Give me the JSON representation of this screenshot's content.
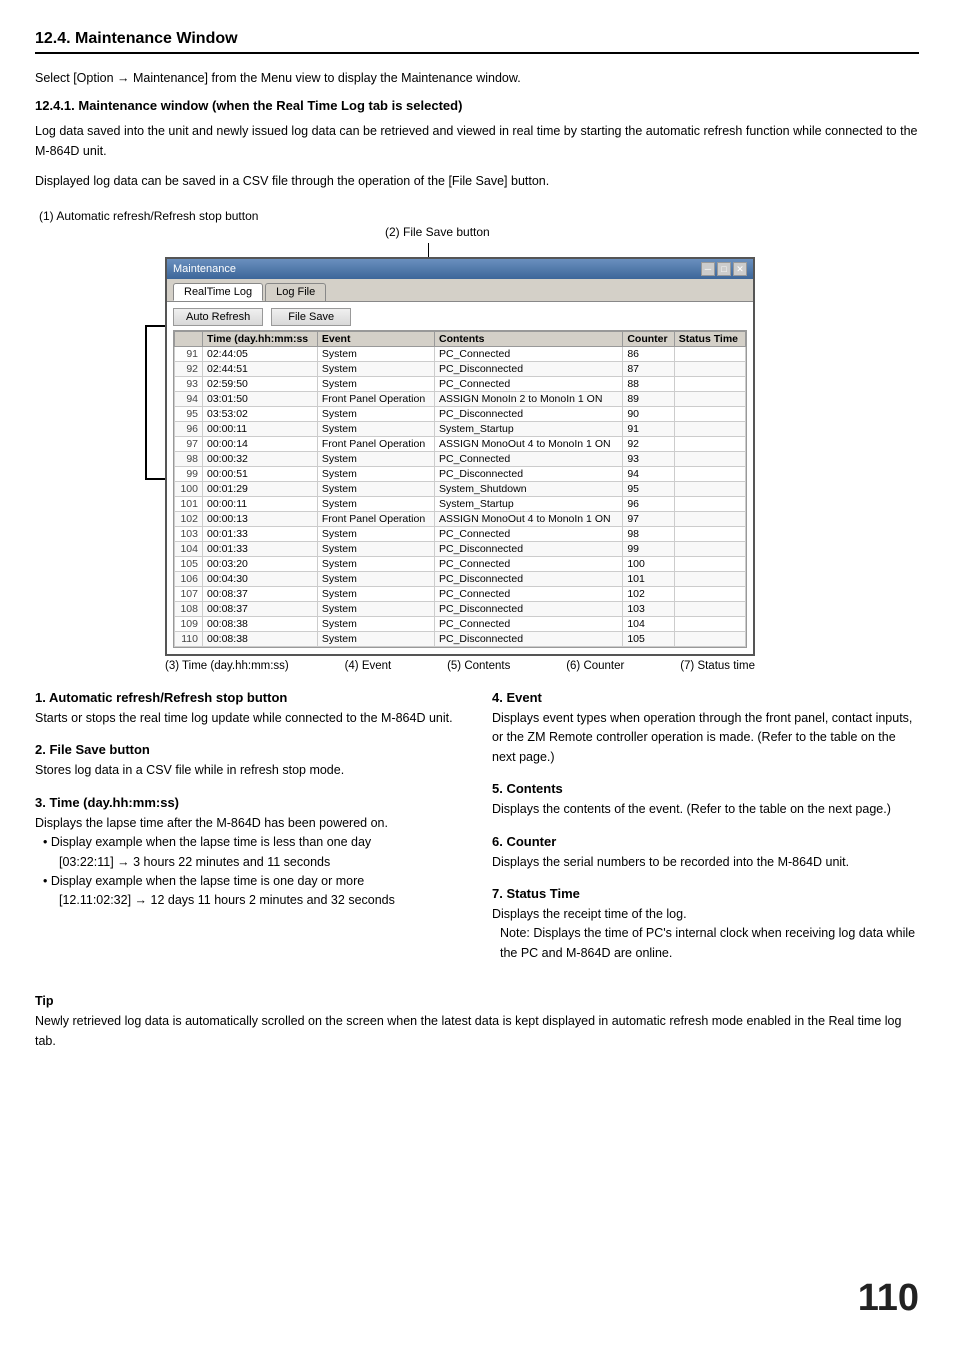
{
  "title": "12.4. Maintenance Window",
  "intro": "Select [Option → Maintenance] from the Menu view to display the Maintenance window.",
  "subtitle": "12.4.1. Maintenance window (when the Real Time Log tab is selected)",
  "description1": "Log data saved into the unit and newly issued log data can be retrieved and viewed in real time by starting the automatic refresh function while connected to the M-864D unit.",
  "description2": "Displayed log data can be saved in a CSV file through the operation of the [File Save] button.",
  "callout1": "(1) Automatic refresh/Refresh stop button",
  "callout2": "(2) File Save button",
  "window_title": "Maintenance",
  "tab_realtime": "RealTime Log",
  "tab_logfile": "Log File",
  "btn_auto_refresh": "Auto Refresh",
  "btn_file_save": "File Save",
  "table_headers": [
    "",
    "Time (day.hh:mm:ss)",
    "Event",
    "Contents",
    "Counter",
    "Status Time"
  ],
  "table_rows": [
    [
      "91",
      "02:44:05",
      "System",
      "PC_Connected",
      "86",
      ""
    ],
    [
      "92",
      "02:44:51",
      "System",
      "PC_Disconnected",
      "87",
      ""
    ],
    [
      "93",
      "02:59:50",
      "System",
      "PC_Connected",
      "88",
      ""
    ],
    [
      "94",
      "03:01:50",
      "Front Panel Operation",
      "ASSIGN MonoIn 2 to MonoIn 1  ON",
      "89",
      ""
    ],
    [
      "95",
      "03:53:02",
      "System",
      "PC_Disconnected",
      "90",
      ""
    ],
    [
      "96",
      "00:00:11",
      "System",
      "System_Startup",
      "91",
      ""
    ],
    [
      "97",
      "00:00:14",
      "Front Panel Operation",
      "ASSIGN MonoOut 4 to MonoIn 1  ON",
      "92",
      ""
    ],
    [
      "98",
      "00:00:32",
      "System",
      "PC_Connected",
      "93",
      ""
    ],
    [
      "99",
      "00:00:51",
      "System",
      "PC_Disconnected",
      "94",
      ""
    ],
    [
      "100",
      "00:01:29",
      "System",
      "System_Shutdown",
      "95",
      ""
    ],
    [
      "101",
      "00:00:11",
      "System",
      "System_Startup",
      "96",
      ""
    ],
    [
      "102",
      "00:00:13",
      "Front Panel Operation",
      "ASSIGN MonoOut 4 to MonoIn 1  ON",
      "97",
      ""
    ],
    [
      "103",
      "00:01:33",
      "System",
      "PC_Connected",
      "98",
      ""
    ],
    [
      "104",
      "00:01:33",
      "System",
      "PC_Disconnected",
      "99",
      ""
    ],
    [
      "105",
      "00:03:20",
      "System",
      "PC_Connected",
      "100",
      ""
    ],
    [
      "106",
      "00:04:30",
      "System",
      "PC_Disconnected",
      "101",
      ""
    ],
    [
      "107",
      "00:08:37",
      "System",
      "PC_Connected",
      "102",
      ""
    ],
    [
      "108",
      "00:08:37",
      "System",
      "PC_Disconnected",
      "103",
      ""
    ],
    [
      "109",
      "00:08:38",
      "System",
      "PC_Connected",
      "104",
      ""
    ],
    [
      "110",
      "00:08:38",
      "System",
      "PC_Disconnected",
      "105",
      ""
    ]
  ],
  "bottom_labels": [
    "(3) Time (day.hh:mm:ss)",
    "(4) Event",
    "(5) Contents",
    "(6) Counter",
    "(7) Status time"
  ],
  "sections": {
    "s1_title": "1. Automatic refresh/Refresh stop button",
    "s1_body": "Starts or stops the real time log update while connected to the M-864D unit.",
    "s2_title": "2. File Save button",
    "s2_body": "Stores log data in a CSV file while in refresh stop mode.",
    "s3_title": "3. Time (day.hh:mm:ss)",
    "s3_body": "Displays the lapse time after the M-864D has been powered on.",
    "s3_bullet1": "Display example when the lapse time is less than one day",
    "s3_example1": "[03:22:11] → 3 hours 22 minutes and 11 seconds",
    "s3_bullet2": "Display example when the lapse time is one day or more",
    "s3_example2": "[12.11:02:32] → 12 days 11 hours 2 minutes and 32 seconds",
    "s4_title": "4. Event",
    "s4_body": "Displays event types when operation through the front panel, contact inputs, or the ZM Remote controller operation is made. (Refer to the table on the next page.)",
    "s5_title": "5. Contents",
    "s5_body": "Displays the contents of the event. (Refer to the table on the next page.)",
    "s6_title": "6. Counter",
    "s6_body": "Displays the serial numbers to be recorded into the M-864D unit.",
    "s7_title": "7. Status Time",
    "s7_body": "Displays the receipt time of the log.",
    "s7_note": "Note: Displays the time of PC's internal clock when receiving log data while the PC and M-864D are online."
  },
  "tip_title": "Tip",
  "tip_body": "Newly retrieved log data is automatically scrolled on the screen when the latest data is kept displayed in automatic refresh mode enabled in the Real time log tab.",
  "page_number": "110"
}
